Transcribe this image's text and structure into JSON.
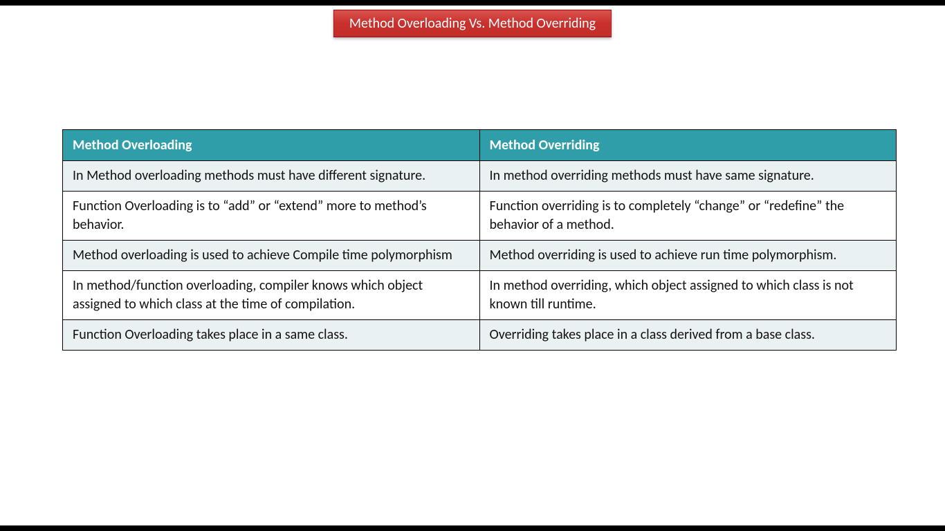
{
  "title": "Method Overloading Vs. Method Overriding",
  "table": {
    "headers": [
      "Method Overloading",
      "Method Overriding"
    ],
    "rows": [
      {
        "left": "In Method overloading methods must have different signature.",
        "right": "In method overriding methods must have same signature."
      },
      {
        "left": "Function Overloading is to “add” or “extend” more to method’s behavior.",
        "right": "Function overriding is to completely “change” or “redefine” the behavior of a method."
      },
      {
        "left": "Method overloading is used to achieve Compile time polymorphism",
        "right": "Method overriding is used to achieve run time polymorphism."
      },
      {
        "left": "In method/function overloading, compiler knows which object assigned to which class at the time of compilation.",
        "right": "In method overriding, which object assigned to which class is not known till runtime."
      },
      {
        "left": "Function Overloading takes place in a same class.",
        "right": "Overriding takes place in a class derived from a base class."
      }
    ]
  }
}
